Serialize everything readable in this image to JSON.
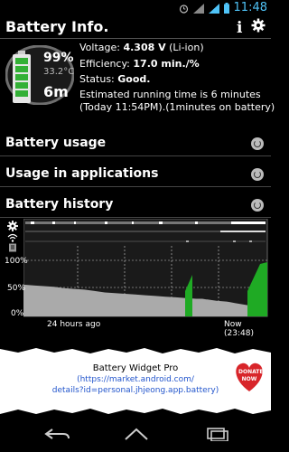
{
  "status_bar": {
    "time": "11:48",
    "icons": [
      "alarm-icon",
      "wifi-icon",
      "signal-icon",
      "battery-icon"
    ]
  },
  "header": {
    "title": "Battery Info."
  },
  "battery": {
    "percent": "99%",
    "temperature": "33.2°C",
    "time_left": "6m",
    "level_fraction": 0.99,
    "voltage_label": "Voltage:",
    "voltage_value": "4.308 V",
    "voltage_type": "(Li-ion)",
    "efficiency_label": "Efficiency:",
    "efficiency_value": "17.0 min./%",
    "status_label": "Status:",
    "status_value": "Good.",
    "estimate_line1": "Estimated running time is 6 minutes",
    "estimate_line2": "(Today 11:54PM).(1minutes on battery)"
  },
  "sections": {
    "usage": "Battery usage",
    "apps": "Usage in applications",
    "history": "Battery history"
  },
  "chart_data": {
    "type": "area",
    "ylabels": [
      "100%",
      "50%",
      "0%"
    ],
    "xlabel_left": "24 hours ago",
    "xlabel_right": "Now (23:48)",
    "ylim": [
      0,
      100
    ],
    "series": [
      {
        "x": [
          0,
          5,
          10,
          15,
          20,
          25,
          30,
          35,
          40,
          45,
          50,
          55,
          60,
          65,
          70,
          75,
          80,
          85,
          88,
          90,
          90.5,
          95,
          100,
          102,
          104,
          106,
          108,
          110,
          112,
          114,
          116,
          118,
          120
        ],
        "values": [
          45,
          44,
          43,
          42,
          40,
          39,
          38,
          36,
          34,
          33,
          32,
          31,
          30,
          29,
          28,
          27,
          26,
          25,
          25,
          24,
          24,
          22,
          21,
          20,
          19,
          18,
          17,
          16,
          15,
          14,
          13,
          12,
          11
        ],
        "color": "#aaaaaa"
      }
    ]
  },
  "ad": {
    "title": "Battery Widget Pro",
    "link_line1": "(https://market.android.com/",
    "link_line2": "details?id=personal.jhjeong.app.battery)",
    "donate": "DONATE NOW"
  }
}
